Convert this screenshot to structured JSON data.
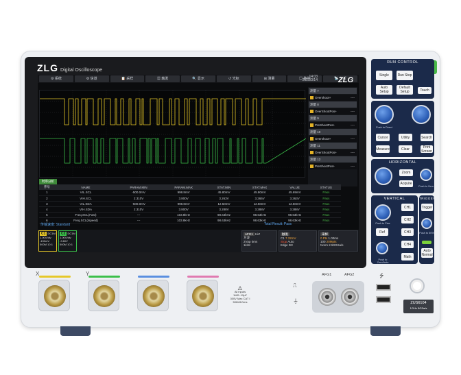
{
  "brand": {
    "logo": "ZLG",
    "subtitle": "Digital Oscilloscope",
    "logo_small": "ZLG"
  },
  "status": {
    "time": "14:03",
    "date": "2023/3/14"
  },
  "menu": [
    "⚙ 系统",
    "⚙ 信道",
    "📋 采样",
    "▦ 触发",
    "🔍 显示",
    "↺ 光标",
    "⊞ 测量",
    "▤ 数学",
    "📡 分析"
  ],
  "meas_panel": [
    {
      "type": "h",
      "label": "测量 7"
    },
    {
      "type": "v",
      "label": "Overshoot+",
      "value": "----"
    },
    {
      "type": "h",
      "label": "测量 8"
    },
    {
      "type": "v",
      "label": "OverShootPos+",
      "value": "----"
    },
    {
      "type": "h",
      "label": "测量 9"
    },
    {
      "type": "v",
      "label": "PreShootPos+",
      "value": "----"
    },
    {
      "type": "h",
      "label": "测量 10"
    },
    {
      "type": "v",
      "label": "Overshoot+",
      "value": "----"
    },
    {
      "type": "h",
      "label": "测量 11"
    },
    {
      "type": "v",
      "label": "OverShootPos+",
      "value": "----"
    },
    {
      "type": "h",
      "label": "测量 12"
    },
    {
      "type": "v",
      "label": "PreShootPos+",
      "value": "----"
    }
  ],
  "table": {
    "tab": "时序分析",
    "headers": [
      "序号",
      "NAME",
      "PARAM.MIN",
      "PARAM.MAX",
      "STAT.MIN",
      "STAT.MAX",
      "VALUE",
      "STATUS"
    ],
    "rows": [
      [
        "1",
        "VIL.SCL",
        "-500.0mV",
        "998.8mV",
        "45.80mV",
        "45.80mV",
        "45.69mV",
        "Pass"
      ],
      [
        "2",
        "VIH.SCL",
        "2.310V",
        "3.800V",
        "3.263V",
        "3.265V",
        "3.263V",
        "Pass"
      ],
      [
        "3",
        "VIL.SDA",
        "-500.0mV",
        "998.8mV",
        "12.50mV",
        "12.50mV",
        "12.50mV",
        "Pass"
      ],
      [
        "4",
        "VIH.SDA",
        "2.310V",
        "3.800V",
        "3.288V",
        "3.288V",
        "3.288V",
        "Pass"
      ],
      [
        "5",
        "Freq.SCL(Fast)",
        "---",
        "103.8kHz",
        "98.63kHz",
        "98.63kHz",
        "98.63kHz",
        "Pass"
      ],
      [
        "6",
        "Freq.SCL(Ispeed)",
        "---",
        "103.8kHz",
        "98.63kHz",
        "98.63kHz",
        "98.63kHz",
        "Pass"
      ]
    ],
    "standard": "传输速度: Standard",
    "total": "Total Result: Pass"
  },
  "channels": [
    {
      "name": "C1",
      "coupling": "DC1M",
      "scale": "1.00V/div",
      "offset": "-130mV",
      "bw": "500M",
      "probe": "10:1"
    },
    {
      "name": "C2",
      "coupling": "DC1M",
      "scale": "1.00V/div",
      "offset": "-3.60V",
      "bw": "500M",
      "probe": "10:1"
    }
  ],
  "bottom": {
    "afg": "AFG1",
    "afg2": "HiZ",
    "freq_label": "方波",
    "freq": "2Vpp 0ms",
    "freq2": "1kHz",
    "trig_title": "触发",
    "trig_ch": "C1",
    "trig_level": "7.32mV",
    "trig_mode": "Stop",
    "trig_auto": "Auto",
    "trig_dc": "DC",
    "trig_edge": "Edge",
    "acq_title": "采样",
    "acq1": "0 Pts",
    "acq1v": "1.00ms",
    "acq2": "100",
    "acq2v": "20Mpts",
    "acq3": "Norm",
    "acq3v": "2.50GSa/s",
    "acq_sub": "ZOOM",
    "acq_sub2": "0.00ms"
  },
  "run_control": {
    "title": "RUN CONTROL",
    "single": "Single",
    "run": "Run Stop",
    "auto": "Auto Setup",
    "default": "Default Setup",
    "touch": "Touch"
  },
  "general": {
    "cursor": "Cursor",
    "utility": "Utility",
    "search": "Search",
    "measure": "Measure",
    "clear": "Clear",
    "print": "Print Screen",
    "push1": "Push to Direct"
  },
  "horizontal": {
    "title": "HORIZONTAL",
    "zoom": "Zoom",
    "acquire": "Acquire",
    "push": "Push to Zero",
    "push2": "Push to Coarse/Fine"
  },
  "vertical": {
    "title": "VERTICAL",
    "ch1": "CH1",
    "ch2": "CH2",
    "ch3": "CH3",
    "ch4": "CH4",
    "ref": "Ref",
    "math": "Math",
    "push": "Push to Fine",
    "push2": "Push to Zero/Auto"
  },
  "trigger": {
    "title": "TRIGGER",
    "trigger": "Trigger",
    "auto_normal": "Auto Normal",
    "force": "Force",
    "push": "Push to 50%"
  },
  "front": {
    "x": "X",
    "y": "Y",
    "warning": "All inputs 1MΩ~15pF 300V Max CAT I 50Ω≤5Vrms",
    "afg1": "AFG1",
    "afg2": "AFG2",
    "model": "ZUS6104",
    "model_sub": "1GHz 5GSa/s"
  },
  "colors": {
    "ch1": "#e6c829",
    "ch2": "#3bbf4a",
    "ch3": "#5a8fe0",
    "ch4": "#e07ab0",
    "accent": "#3f7fd8",
    "panel": "#1b2a4a"
  }
}
